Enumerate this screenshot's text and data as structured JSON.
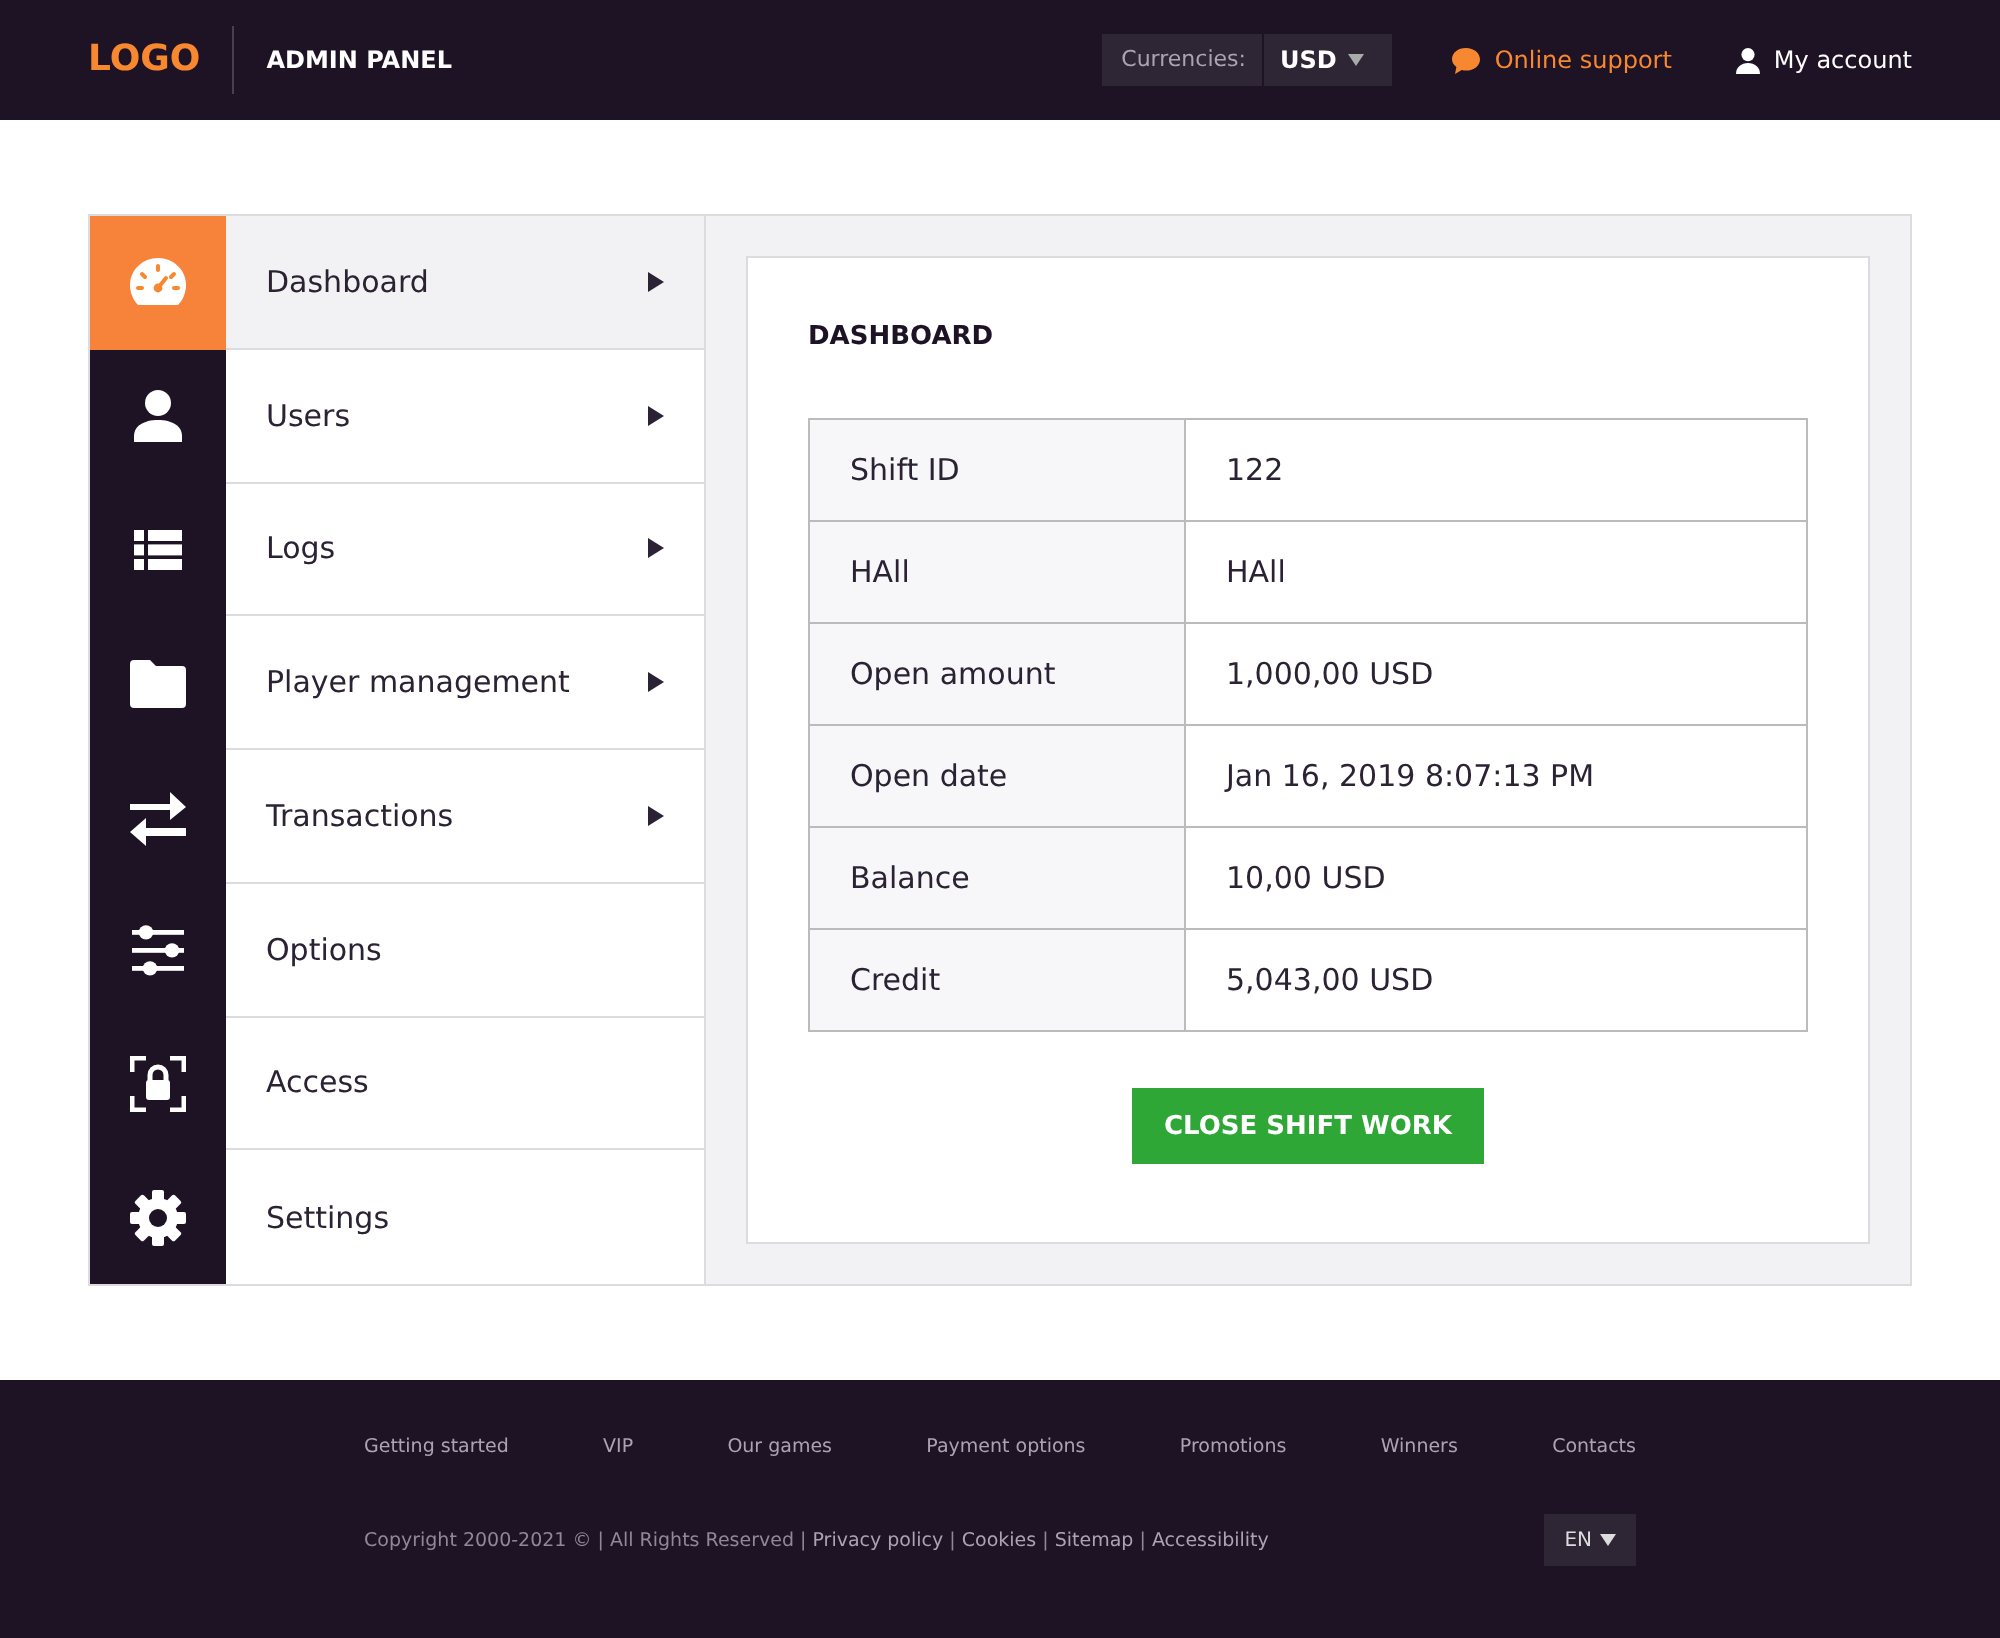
{
  "header": {
    "logo": "LOGO",
    "title": "ADMIN PANEL",
    "currency_label": "Currencies:",
    "currency": "USD",
    "support": "Online support",
    "account": "My account"
  },
  "menu": [
    {
      "kind": "gauge",
      "label": "Dashboard",
      "has_submenu": true,
      "selected": true
    },
    {
      "kind": "user",
      "label": "Users",
      "has_submenu": true,
      "selected": false
    },
    {
      "kind": "list",
      "label": "Logs",
      "has_submenu": true,
      "selected": false
    },
    {
      "kind": "folder",
      "label": "Player management",
      "has_submenu": true,
      "selected": false
    },
    {
      "kind": "transfer",
      "label": "Transactions",
      "has_submenu": true,
      "selected": false
    },
    {
      "kind": "sliders",
      "label": "Options",
      "has_submenu": false,
      "selected": false
    },
    {
      "kind": "lock",
      "label": "Access",
      "has_submenu": false,
      "selected": false
    },
    {
      "kind": "gear",
      "label": "Settings",
      "has_submenu": false,
      "selected": false
    }
  ],
  "dashboard": {
    "title": "DASHBOARD",
    "rows": [
      {
        "label": "Shift ID",
        "value": "122"
      },
      {
        "label": "HAll",
        "value": "HAll"
      },
      {
        "label": "Open amount",
        "value": "1,000,00 USD"
      },
      {
        "label": "Open date",
        "value": "Jan 16, 2019 8:07:13 PM"
      },
      {
        "label": "Balance",
        "value": "10,00 USD"
      },
      {
        "label": "Credit",
        "value": "5,043,00 USD"
      }
    ],
    "button": "CLOSE SHIFT WORK"
  },
  "footer": {
    "links": [
      "Getting started",
      "VIP",
      "Our games",
      "Payment options",
      "Promotions",
      "Winners",
      "Contacts"
    ],
    "legal": [
      {
        "kind": "text",
        "text": "Copyright 2000-2021 © | All Rights Reserved | "
      },
      {
        "kind": "link",
        "text": "Privacy policy"
      },
      {
        "kind": "text",
        "text": " | "
      },
      {
        "kind": "link",
        "text": "Cookies"
      },
      {
        "kind": "text",
        "text": " | "
      },
      {
        "kind": "link",
        "text": "Sitemap"
      },
      {
        "kind": "text",
        "text": " | "
      },
      {
        "kind": "link",
        "text": "Accessibility"
      }
    ],
    "language": "EN"
  }
}
